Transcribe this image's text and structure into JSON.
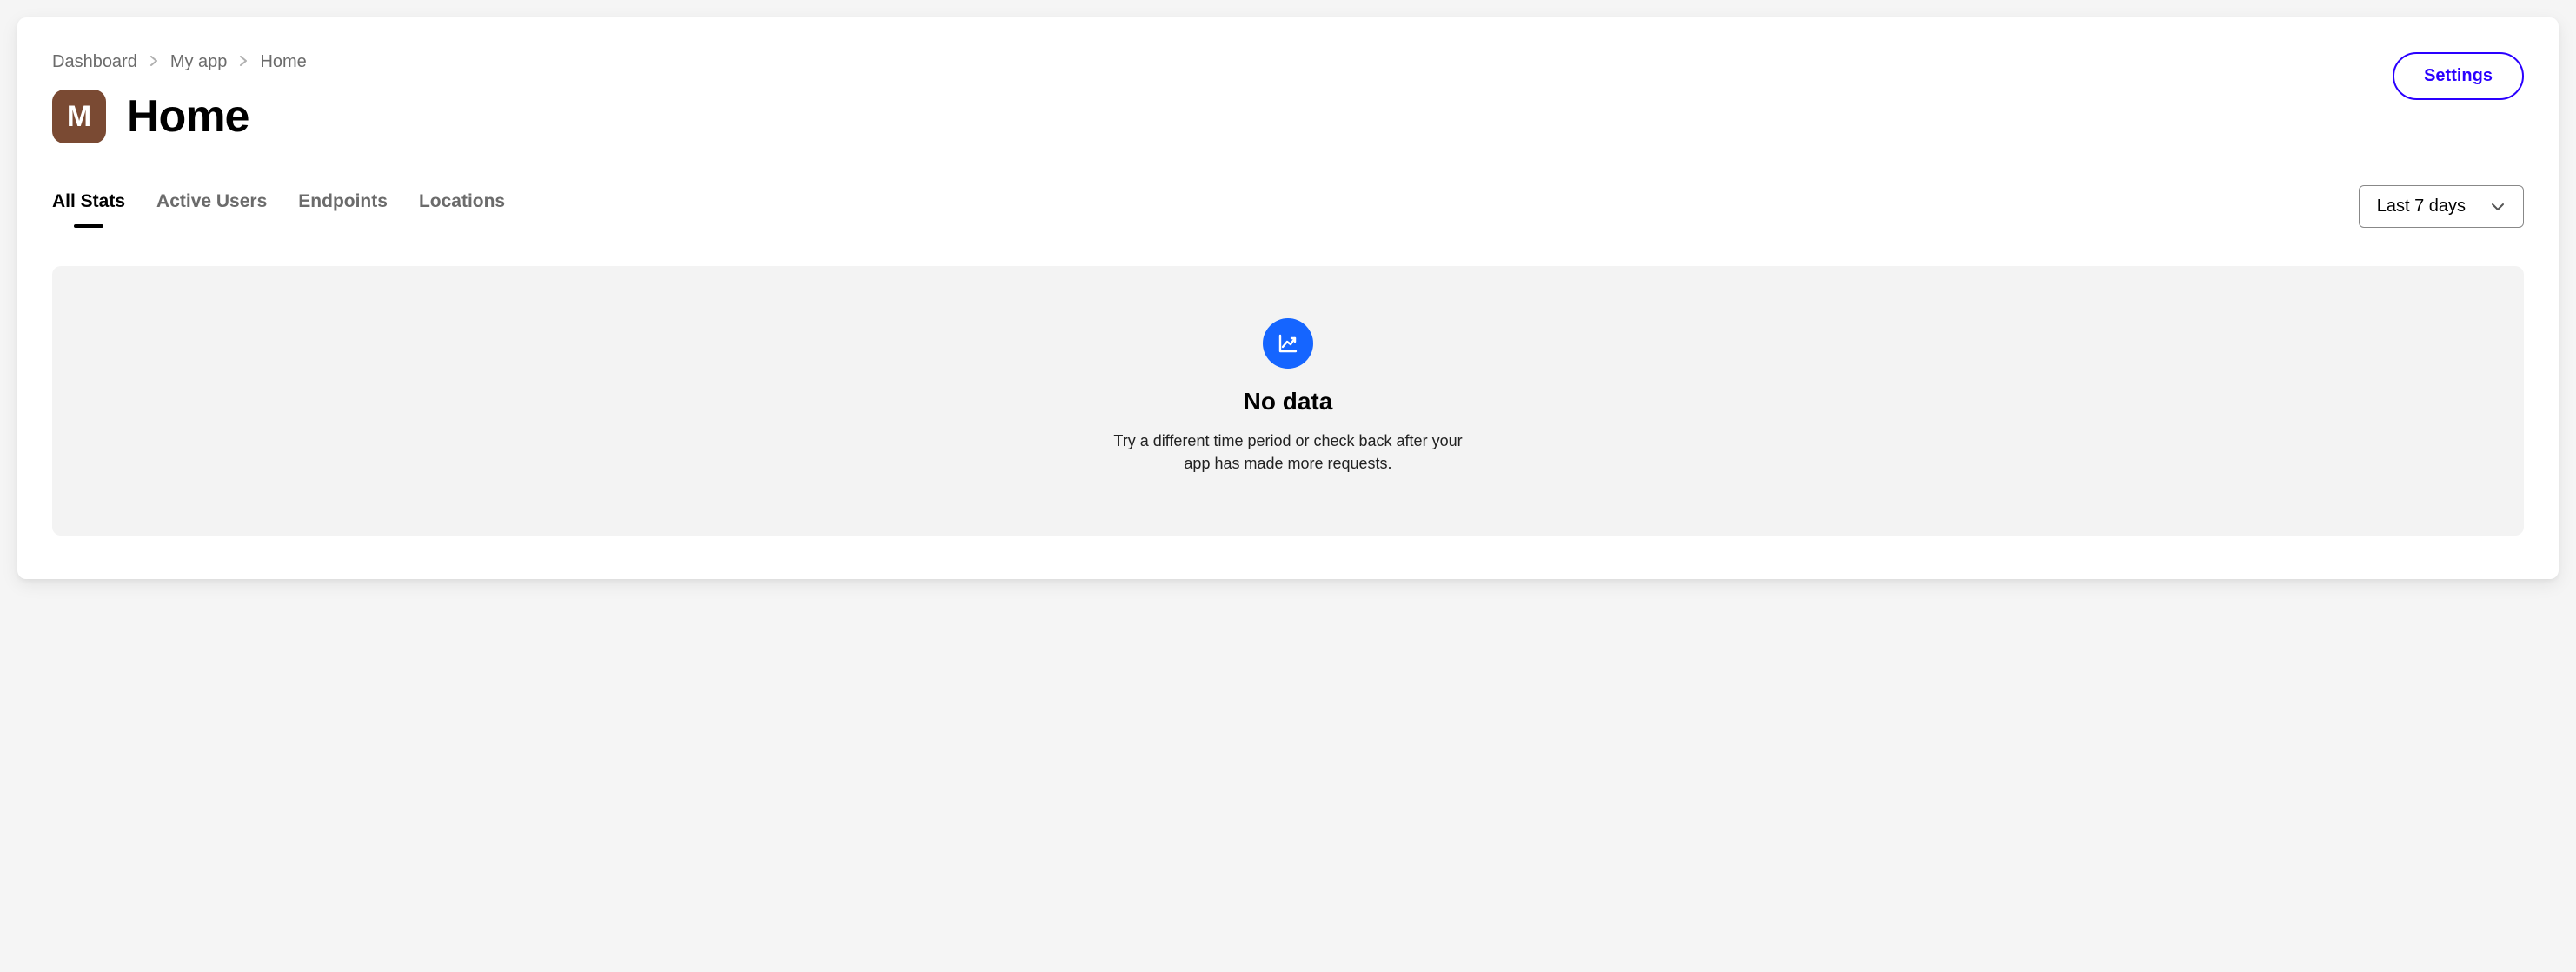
{
  "breadcrumb": {
    "items": [
      "Dashboard",
      "My app",
      "Home"
    ]
  },
  "header": {
    "settings_label": "Settings",
    "app_icon_letter": "M",
    "page_title": "Home"
  },
  "tabs": {
    "items": [
      "All Stats",
      "Active Users",
      "Endpoints",
      "Locations"
    ],
    "active_index": 0
  },
  "range_selector": {
    "selected": "Last 7 days"
  },
  "empty_state": {
    "title": "No data",
    "body": "Try a different time period or check back after your app has made more requests."
  }
}
